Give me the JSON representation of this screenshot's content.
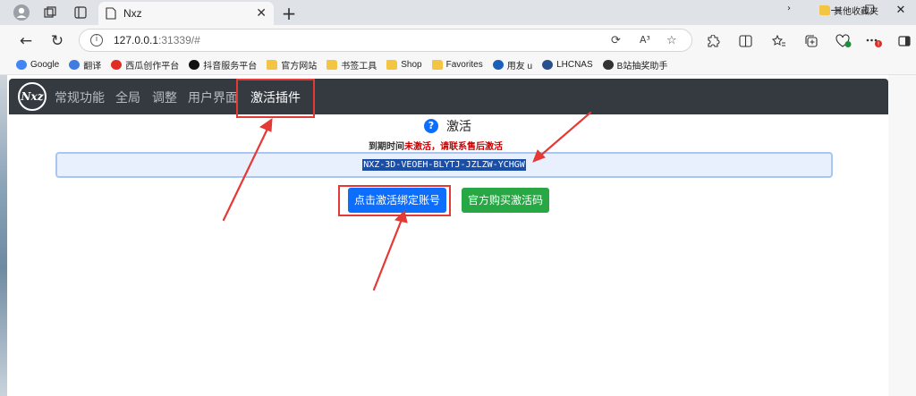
{
  "browser": {
    "tab_title": "Nxz",
    "url_host": "127.0.0.1",
    "url_path": ":31339/#",
    "read_aloud_label": "A³"
  },
  "bookmarks": {
    "items": [
      {
        "label": "Google",
        "icon": "google-icon",
        "color": "#4285f4"
      },
      {
        "label": "翻译",
        "icon": "translate-icon",
        "color": "#3f7be0"
      },
      {
        "label": "西瓜创作平台",
        "icon": "xigua-icon",
        "color": "#e02e24"
      },
      {
        "label": "抖音服务平台",
        "icon": "douyin-icon",
        "color": "#111111"
      },
      {
        "label": "官方网站",
        "icon": "folder-icon",
        "color": "#f4c542"
      },
      {
        "label": "书签工具",
        "icon": "folder-icon",
        "color": "#f4c542"
      },
      {
        "label": "Shop",
        "icon": "folder-icon",
        "color": "#f4c542"
      },
      {
        "label": "Favorites",
        "icon": "folder-icon",
        "color": "#f4c542"
      },
      {
        "label": "用友 u",
        "icon": "yonyou-icon",
        "color": "#1c5fb8"
      },
      {
        "label": "LHCNAS",
        "icon": "nas-icon",
        "color": "#2a4f8f"
      },
      {
        "label": "B站抽奖助手",
        "icon": "bilibili-helper-icon",
        "color": "#333333"
      }
    ],
    "other_label": "其他收藏夹"
  },
  "app": {
    "logo_text": "Nxz",
    "nav": [
      {
        "label": "常规功能",
        "active": false
      },
      {
        "label": "全局",
        "active": false
      },
      {
        "label": "调整",
        "active": false
      },
      {
        "label": "用户界面",
        "active": false
      },
      {
        "label": "激活插件",
        "active": true
      }
    ]
  },
  "activation": {
    "title": "激活",
    "expiry_label": "到期时间",
    "expiry_value": "未激活，请联系售后激活",
    "code": "NXZ-3D-VEOEH-BLYTJ-JZLZW-YCHGW",
    "bind_button": "点击激活绑定账号",
    "buy_button": "官方购买激活码"
  },
  "colors": {
    "nav_bg": "#343a40",
    "primary": "#0d6efd",
    "success": "#28a745",
    "danger_text": "#cc0000",
    "annotation": "#e53935"
  }
}
